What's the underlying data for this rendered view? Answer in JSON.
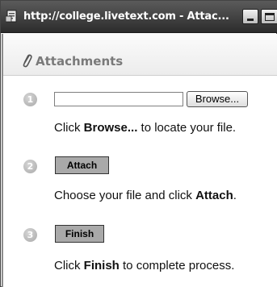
{
  "window": {
    "title": "http://college.livetext.com - Attac..."
  },
  "header": {
    "title": "Attachments",
    "icon": "paperclip-icon"
  },
  "steps": [
    {
      "number": "1",
      "browse_label": "Browse...",
      "file_value": "",
      "instruction": {
        "pre": "Click ",
        "bold": "Browse...",
        "post": " to locate your file."
      }
    },
    {
      "number": "2",
      "button_label": "Attach",
      "instruction": {
        "pre": "Choose your file and click ",
        "bold": "Attach",
        "post": "."
      }
    },
    {
      "number": "3",
      "button_label": "Finish",
      "instruction": {
        "pre": "Click ",
        "bold": "Finish",
        "post": " to complete process."
      }
    }
  ]
}
